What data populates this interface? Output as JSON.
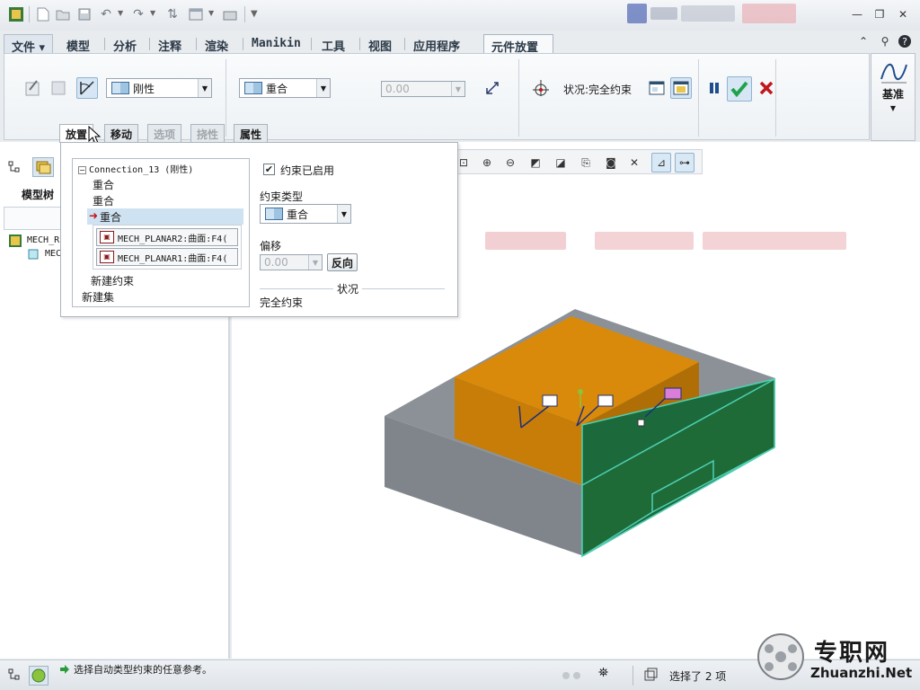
{
  "ribbon_tabs": {
    "file": "文件",
    "items": [
      "模型",
      "分析",
      "注释",
      "渲染",
      "Manikin",
      "工具",
      "视图",
      "应用程序"
    ],
    "active": "元件放置"
  },
  "ribbon": {
    "connection_type": "刚性",
    "constraint_type": "重合",
    "offset_value": "0.00",
    "status_label": "状况:完全约束",
    "datum_label": "基准"
  },
  "left_panel": {
    "model_tree_label": "模型树",
    "tree_items": [
      "MECH_R",
      "MEC"
    ]
  },
  "panel_tabs": [
    "放置",
    "移动",
    "选项",
    "挠性",
    "属性"
  ],
  "placement": {
    "connection": "Connection_13 (刚性)",
    "constraints": [
      "重合",
      "重合",
      "重合"
    ],
    "refs": [
      "MECH_PLANAR2:曲面:F4(",
      "MECH_PLANAR1:曲面:F4("
    ],
    "new_constraint": "新建约束",
    "new_set": "新建集",
    "enabled_label": "约束已启用",
    "type_label": "约束类型",
    "type_value": "重合",
    "offset_label": "偏移",
    "offset_value": "0.00",
    "flip_button": "反向",
    "status_heading": "状况",
    "status_value": "完全约束"
  },
  "statusbar": {
    "message": "选择自动类型约束的任意参考。",
    "selection": "选择了 2 项"
  },
  "watermark": {
    "cn": "专职网",
    "url": "Zhuanzhi.Net"
  },
  "colors": {
    "accent_blue": "#2f6fa6",
    "orange_part": "#d98a0a",
    "green_part": "#1e6b38",
    "gray_part": "#8a8f96",
    "confirm": "#1fa34a",
    "cancel": "#c0161c"
  }
}
